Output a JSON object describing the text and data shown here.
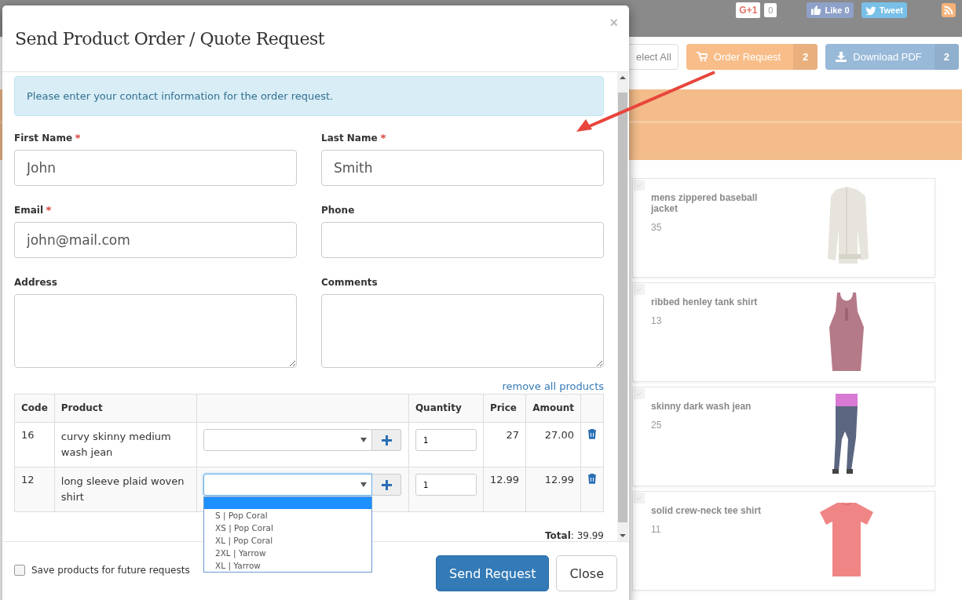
{
  "top_bar": {
    "gplus": {
      "label": "G+1",
      "count": "0"
    },
    "like": "Like 0",
    "tweet": "Tweet"
  },
  "toolbar": {
    "select_all": "elect All",
    "order_request": {
      "label": "Order Request",
      "count": "2"
    },
    "download_pdf": {
      "label": "Download PDF",
      "count": "2"
    }
  },
  "products": [
    {
      "name": "mens zippered baseball jacket",
      "price": "35",
      "kind": "jacket"
    },
    {
      "name": "ribbed henley tank shirt",
      "price": "13",
      "kind": "tank"
    },
    {
      "name": "skinny dark wash jean",
      "price": "25",
      "kind": "jeans"
    },
    {
      "name": "solid crew-neck tee shirt",
      "price": "11",
      "kind": "tee"
    }
  ],
  "modal": {
    "title": "Send Product Order / Quote Request",
    "close": "×",
    "info": "Please enter your contact information for the order request.",
    "fields": [
      {
        "label": "First Name",
        "required": true,
        "value": "John",
        "kind": "input"
      },
      {
        "label": "Last Name",
        "required": true,
        "value": "Smith",
        "kind": "input"
      },
      {
        "label": "Email",
        "required": true,
        "value": "john@mail.com",
        "kind": "input"
      },
      {
        "label": "Phone",
        "required": false,
        "kind": "input"
      },
      {
        "label": "Address",
        "required": false,
        "kind": "textarea"
      },
      {
        "label": "Comments",
        "required": false,
        "kind": "textarea"
      }
    ],
    "remove_all": "remove all products",
    "table": {
      "columns": [
        {
          "label": "Code"
        },
        {
          "label": "Product"
        },
        {
          "kind": "options"
        },
        {
          "label": "Quantity"
        },
        {
          "label": "Price"
        },
        {
          "label": "Amount"
        },
        {
          "kind": "delete"
        }
      ],
      "rows": [
        {
          "code": "16",
          "product": "curvy skinny medium wash jean",
          "quantity": "1",
          "price": "27",
          "amount": "27.00",
          "open": false
        },
        {
          "code": "12",
          "product": "long sleeve plaid woven shirt",
          "quantity": "1",
          "price": "12.99",
          "amount": "12.99",
          "open": true
        }
      ],
      "dropdown": {
        "blank_highlighted": true,
        "options": [
          {
            "label": "S | Pop Coral",
            "selected": false
          },
          {
            "label": "XS | Pop Coral",
            "selected": false
          },
          {
            "label": "XL | Pop Coral",
            "selected": false
          },
          {
            "label": "2XL | Yarrow",
            "selected": false
          },
          {
            "label": "XL | Yarrow",
            "selected": false
          }
        ]
      }
    },
    "total": "**Total**: 39.99",
    "save_products": {
      "label": "Save products for future requests",
      "checked": false
    },
    "buttons": [
      {
        "label": "Send Request",
        "kind": "primary"
      },
      {
        "label": "Close",
        "kind": "default"
      }
    ]
  }
}
